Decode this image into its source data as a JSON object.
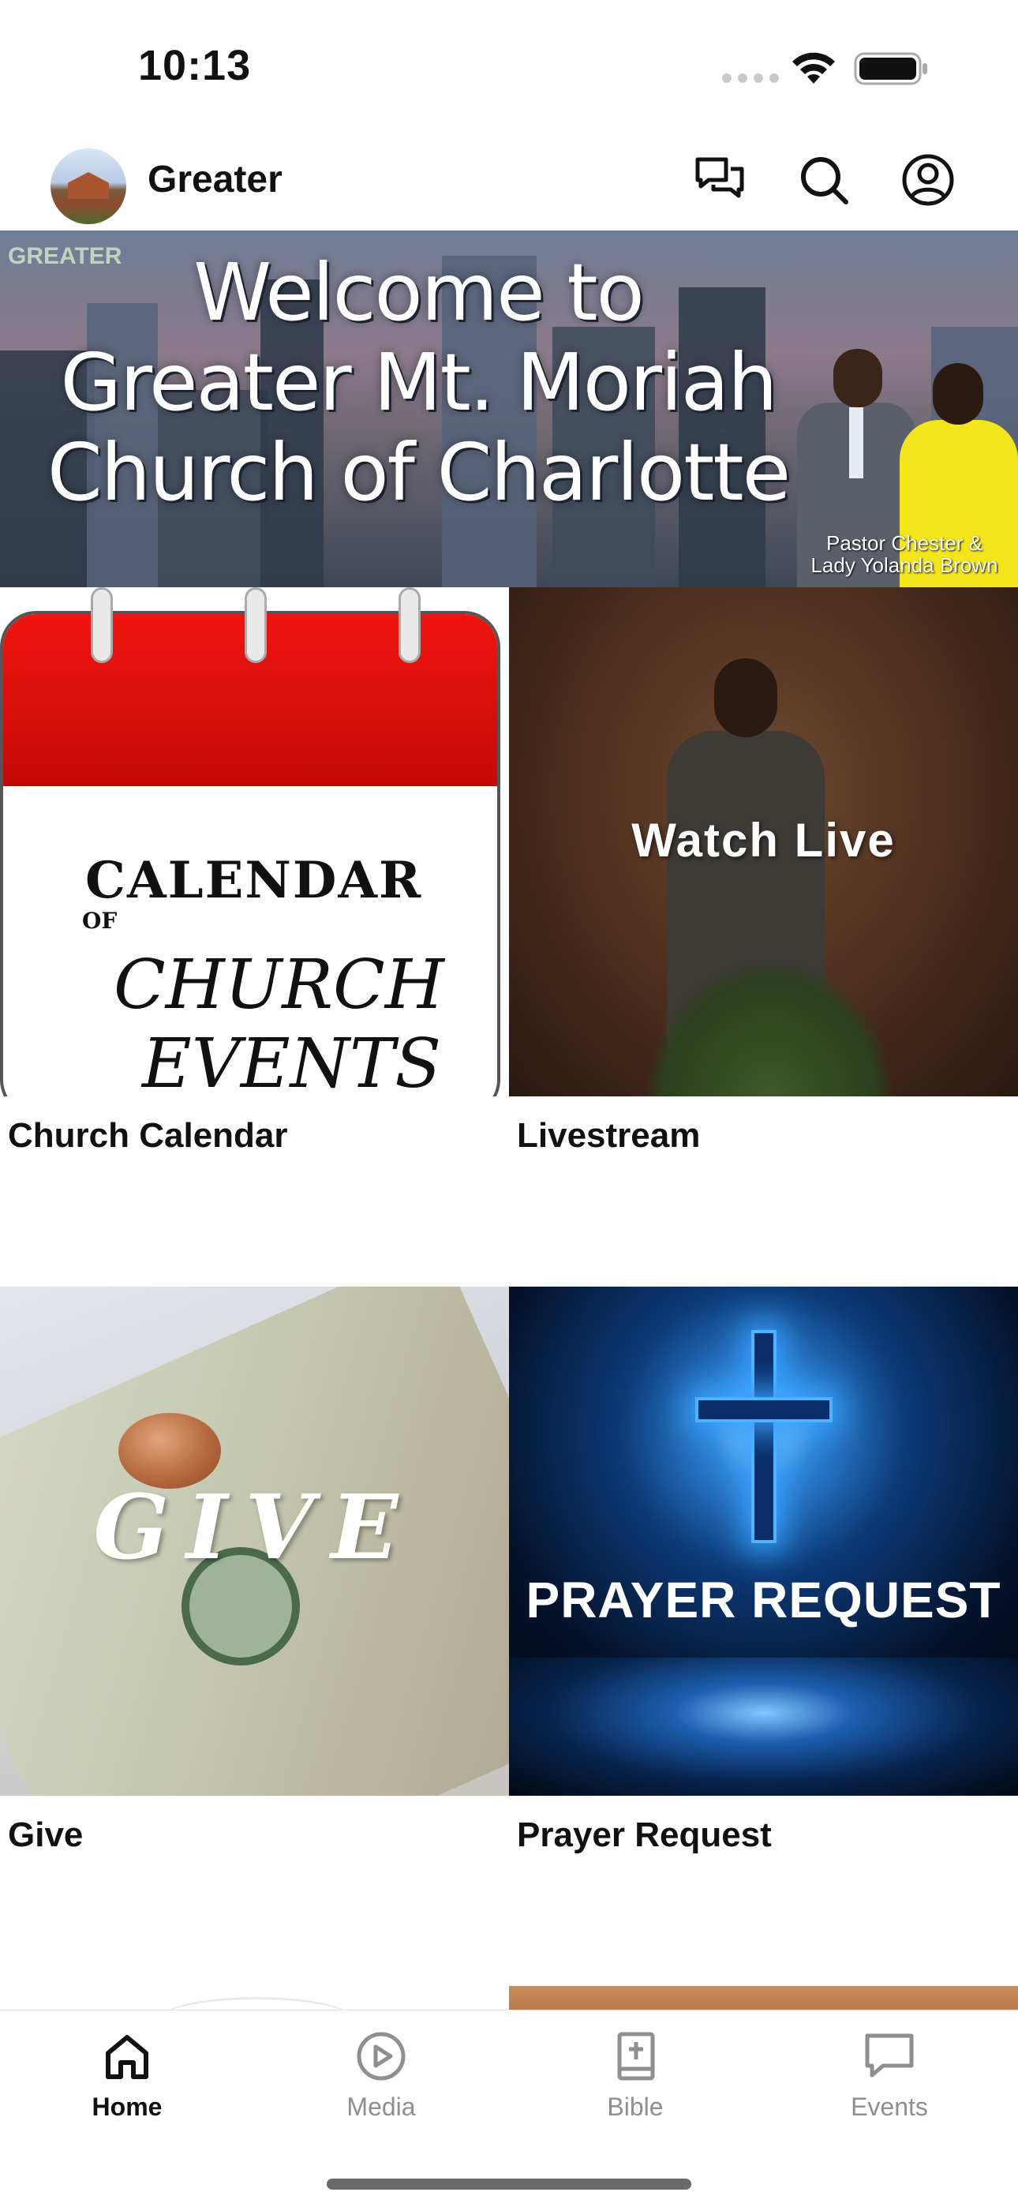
{
  "status_bar": {
    "time": "10:13"
  },
  "header": {
    "title": "Greater",
    "icons": [
      "chat-icon",
      "search-icon",
      "account-icon"
    ]
  },
  "banner": {
    "logo_text": "GREATER",
    "lines": [
      "Welcome to",
      "Greater Mt. Moriah",
      "Church of Charlotte"
    ],
    "caption": [
      "Pastor Chester &",
      "Lady Yolanda Brown"
    ]
  },
  "tiles": [
    {
      "label": "Church Calendar",
      "image_text": {
        "line1": "CALENDAR",
        "of": "OF",
        "line2": "CHURCH",
        "line3": "EVENTS"
      },
      "accent": "#d8100c"
    },
    {
      "label": "Livestream",
      "image_text": "Watch Live"
    },
    {
      "label": "Give",
      "image_text": "GIVE"
    },
    {
      "label": "Prayer Request",
      "image_text": "PRAYER REQUEST",
      "accent": "#2e84d8"
    }
  ],
  "tab_bar": {
    "items": [
      {
        "label": "Home",
        "icon": "home-icon",
        "active": true
      },
      {
        "label": "Media",
        "icon": "play-circle-icon",
        "active": false
      },
      {
        "label": "Bible",
        "icon": "bible-icon",
        "active": false
      },
      {
        "label": "Events",
        "icon": "message-icon",
        "active": false
      }
    ]
  }
}
